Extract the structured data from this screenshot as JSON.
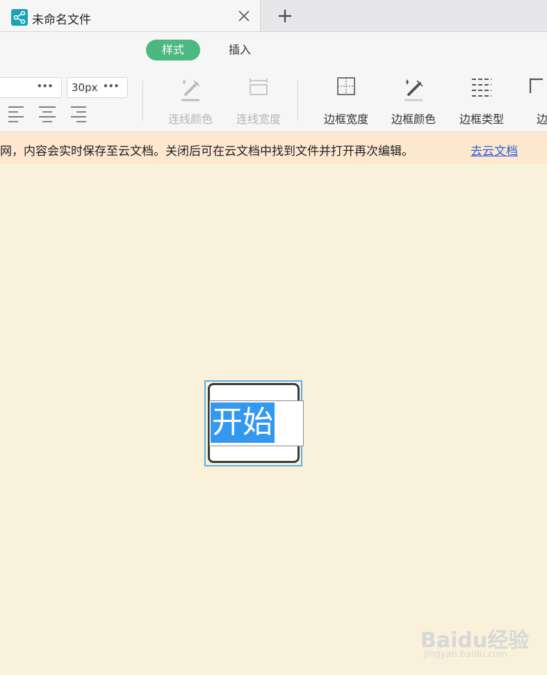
{
  "tab": {
    "title": "未命名文件",
    "new_tab": "+"
  },
  "ribbon": {
    "tabs": [
      {
        "label": "样式",
        "active": true
      },
      {
        "label": "插入",
        "active": false
      }
    ],
    "font_size": "30px",
    "tools": {
      "line_color": {
        "label": "连线颜色",
        "enabled": false
      },
      "line_width": {
        "label": "连线宽度",
        "enabled": false
      },
      "border_width": {
        "label": "边框宽度",
        "enabled": true
      },
      "border_color": {
        "label": "边框颜色",
        "enabled": true
      },
      "border_type": {
        "label": "边框类型",
        "enabled": true
      },
      "border_more": {
        "label": "边",
        "enabled": true
      }
    }
  },
  "notice": {
    "text": "网，内容会实时保存至云文档。关闭后可在云文档中找到文件并打开再次编辑。",
    "link": "去云文档"
  },
  "canvas": {
    "node_text": "开始"
  },
  "watermark": {
    "brand": "Baidu经验",
    "sub": "jingyan.baidu.com"
  },
  "colors": {
    "canvas_bg": "#faf1db",
    "active_tab": "#4bb87f",
    "selection": "#5aaee8",
    "notice_bg": "#fde7cf",
    "link": "#2a5fd9"
  }
}
